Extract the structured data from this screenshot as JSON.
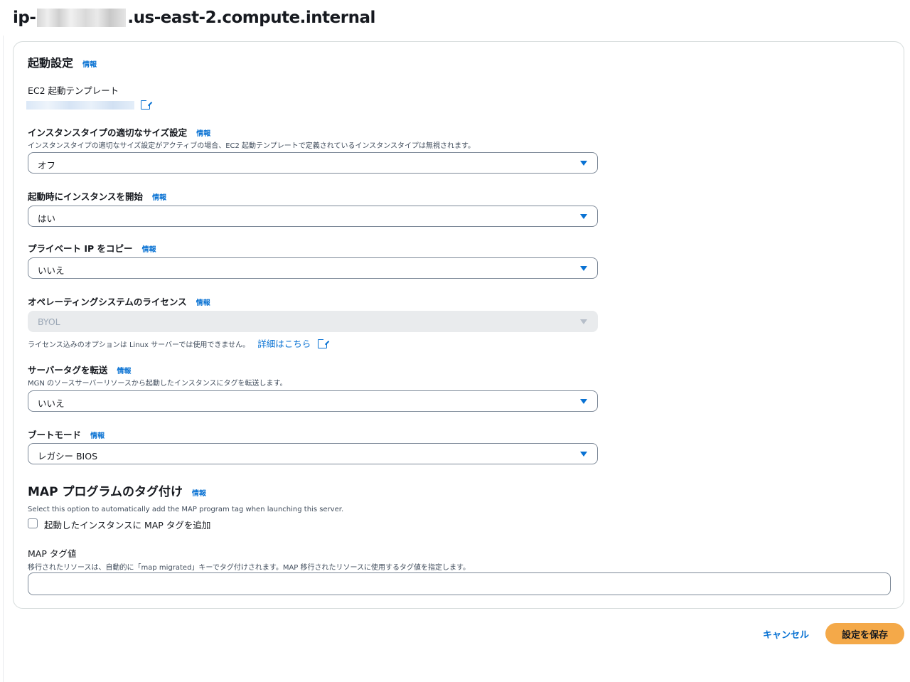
{
  "header": {
    "title_prefix": "ip-",
    "title_suffix": ".us-east-2.compute.internal"
  },
  "launch_settings": {
    "title": "起動設定",
    "info": "情報",
    "ec2_template": {
      "label": "EC2 起動テンプレート"
    },
    "rightsizing": {
      "label": "インスタンスタイプの適切なサイズ設定",
      "info": "情報",
      "description": "インスタンスタイプの適切なサイズ設定がアクティブの場合、EC2 起動テンプレートで定義されているインスタンスタイプは無視されます。",
      "value": "オフ"
    },
    "start_on_launch": {
      "label": "起動時にインスタンスを開始",
      "info": "情報",
      "value": "はい"
    },
    "copy_private_ip": {
      "label": "プライベート IP をコピー",
      "info": "情報",
      "value": "いいえ"
    },
    "os_license": {
      "label": "オペレーティングシステムのライセンス",
      "info": "情報",
      "value": "BYOL",
      "note": "ライセンス込みのオプションは Linux サーバーでは使用できません。",
      "link": "詳細はこちら"
    },
    "transfer_tags": {
      "label": "サーバータグを転送",
      "info": "情報",
      "description": "MGN のソースサーバーリソースから起動したインスタンスにタグを転送します。",
      "value": "いいえ"
    },
    "boot_mode": {
      "label": "ブートモード",
      "info": "情報",
      "value": "レガシー BIOS"
    },
    "map_tagging": {
      "title": "MAP プログラムのタグ付け",
      "info": "情報",
      "description": "Select this option to automatically add the MAP program tag when launching this server.",
      "checkbox_label": "起動したインスタンスに MAP タグを追加",
      "checked": false
    },
    "map_tag_value": {
      "label": "MAP タグ値",
      "description": "移行されたリソースは、自動的に「map migrated」キーでタグ付けされます。MAP 移行されたリソースに使用するタグ値を指定します。",
      "value": ""
    }
  },
  "footer": {
    "cancel_label": "キャンセル",
    "save_label": "設定を保存"
  },
  "colors": {
    "link": "#0972d3",
    "primary_button": "#f4a949",
    "border": "#7d8998",
    "disabled_bg": "#e9ebed"
  }
}
